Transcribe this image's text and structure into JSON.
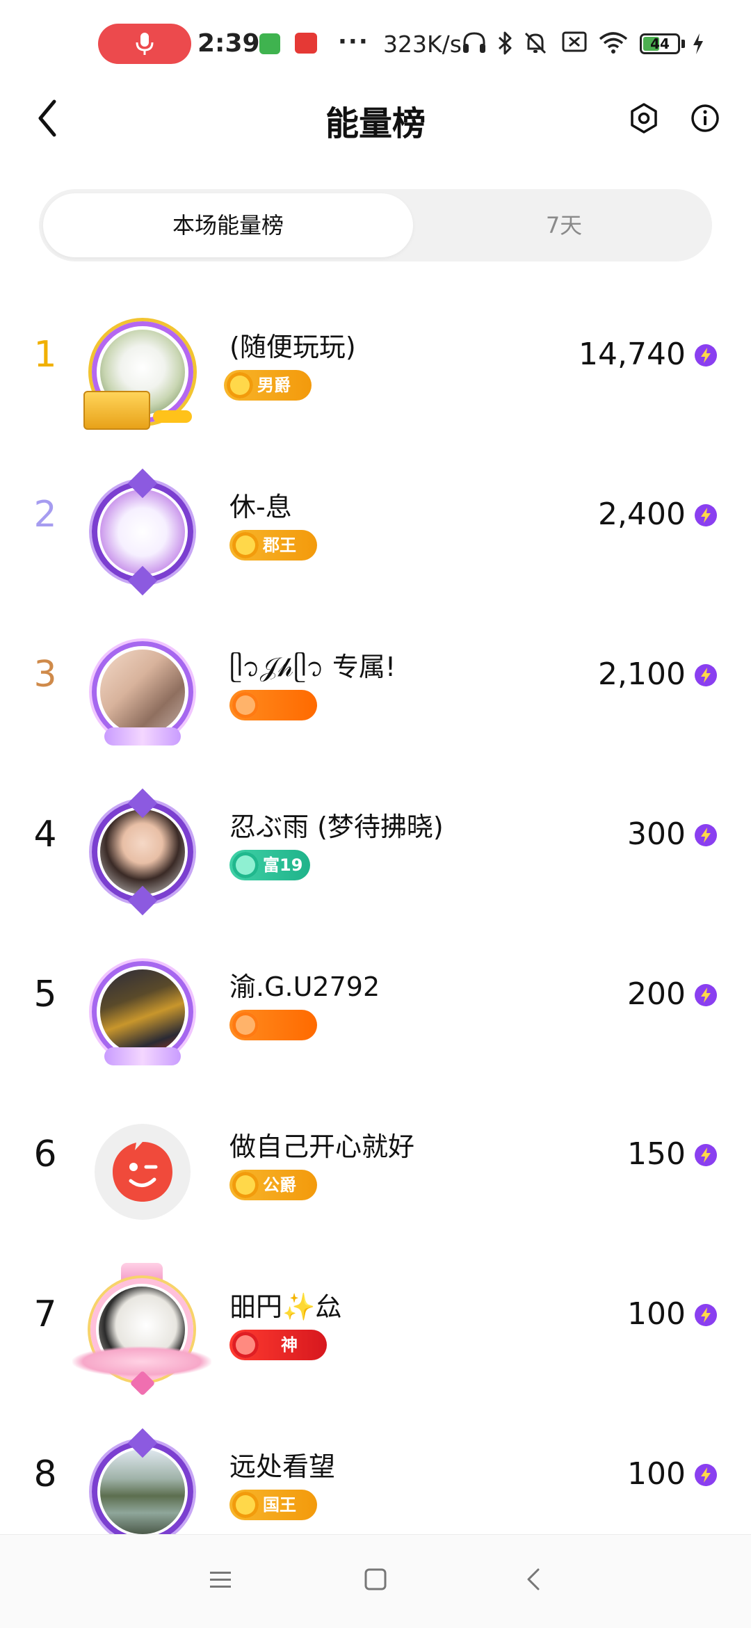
{
  "status_bar": {
    "time": "2:39",
    "more": "···",
    "net_speed": "323K/s",
    "battery_percent": "44",
    "battery_level": 0.44,
    "icons": [
      "mic-icon",
      "app-notification-icon",
      "app-notification-icon",
      "headphones-icon",
      "bluetooth-icon",
      "mute-icon",
      "sim-off-icon",
      "wifi-icon",
      "battery-icon",
      "charging-icon"
    ]
  },
  "header": {
    "title": "能量榜",
    "back_icon": "chevron-left-icon",
    "hex_icon": "hexagon-settings-icon",
    "info_icon": "info-icon"
  },
  "tabs": {
    "active_label": "本场能量榜",
    "inactive_label": "7天"
  },
  "colors": {
    "rank1": "#f0b000",
    "rank2": "#a69cf0",
    "rank3": "#cf8a4a",
    "rank_default": "#111111",
    "badge_gold": "#f4a70f",
    "badge_orange": "#ff7a12",
    "badge_teal": "#2fc39a",
    "badge_red": "#ec2b2b",
    "energy_purple": "#8a3ff0"
  },
  "list": [
    {
      "rank": "1",
      "name": "(随便玩玩)",
      "badge": "男爵",
      "score": "14,740"
    },
    {
      "rank": "2",
      "name": "休-息",
      "badge": "郡王",
      "score": "2,400"
    },
    {
      "rank": "3",
      "name": "ᥫ᭡𝒥𝒽ᥫ᭡ 专属!",
      "badge": "",
      "score": "2,100"
    },
    {
      "rank": "4",
      "name": "忍ぶ雨 (梦待拂晓)",
      "badge": "富19",
      "score": "300"
    },
    {
      "rank": "5",
      "name": "渝.G.U2792",
      "badge": "",
      "score": "200"
    },
    {
      "rank": "6",
      "name": "做自己开心就好",
      "badge": "公爵",
      "score": "150"
    },
    {
      "rank": "7",
      "name": "昍円✨厽",
      "badge": "神",
      "score": "100"
    },
    {
      "rank": "8",
      "name": "远处看望",
      "badge": "国王",
      "score": "100"
    }
  ],
  "nav": {
    "menu_icon": "menu-icon",
    "home_icon": "home-square-icon",
    "back_icon": "back-triangle-icon"
  }
}
